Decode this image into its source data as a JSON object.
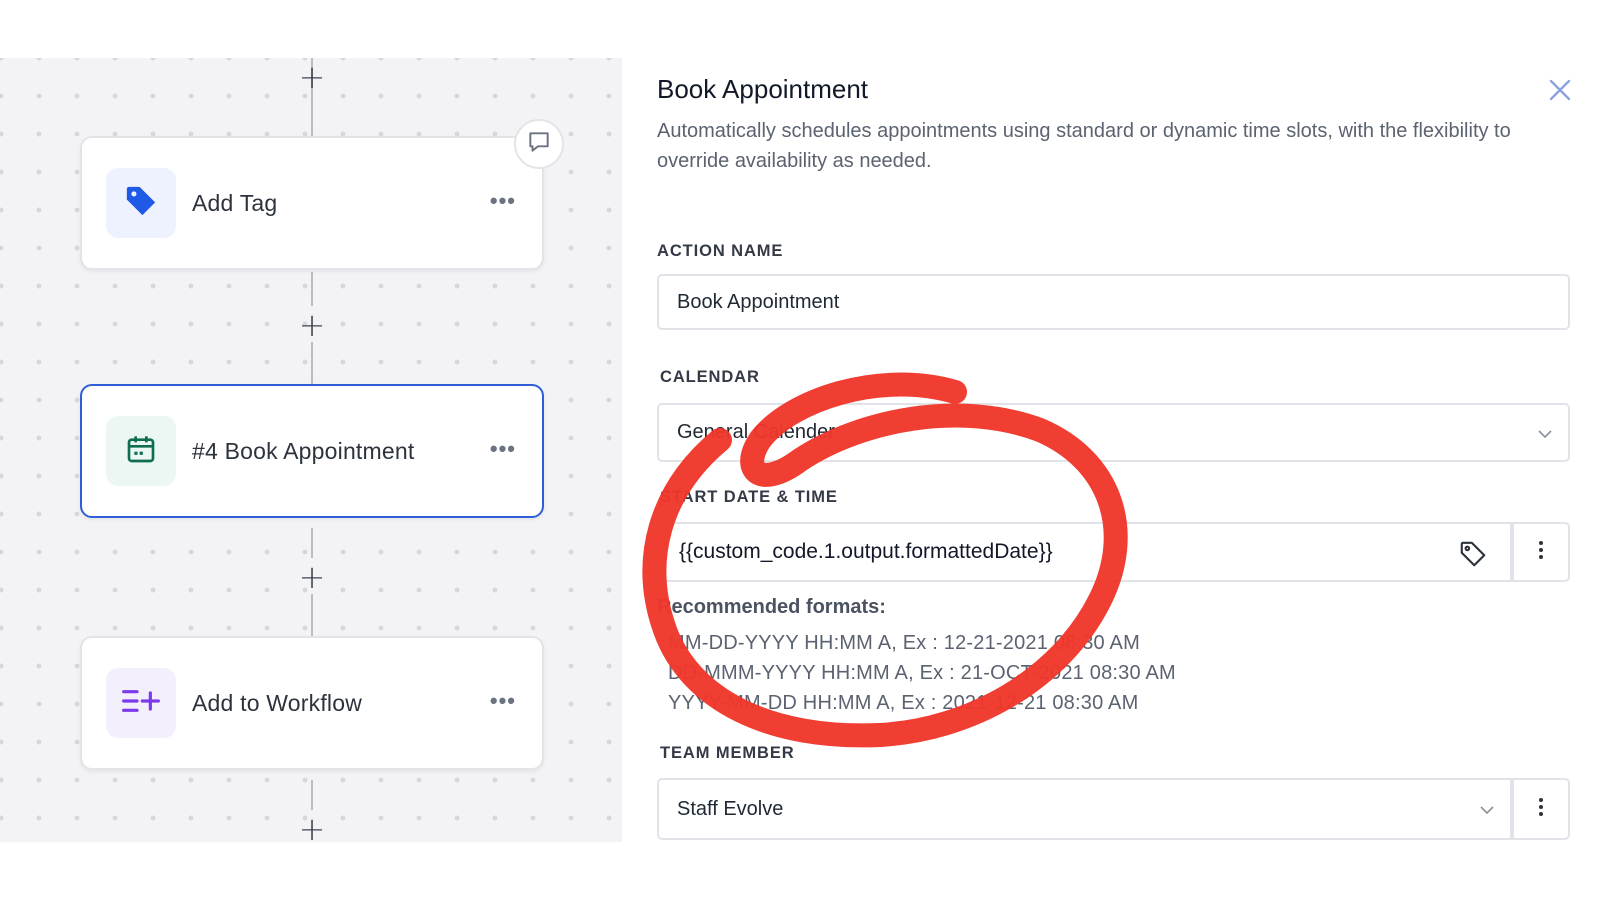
{
  "canvas": {
    "nodes": [
      {
        "label": "Add Tag",
        "icon": "tag-icon",
        "icon_color": "#1f5ae6",
        "icon_bg": "#eef2fe",
        "menu": "•••"
      },
      {
        "label": "#4 Book Appointment",
        "icon": "calendar-icon",
        "icon_color": "#0f6e52",
        "icon_bg": "#ecf7f3",
        "menu": "•••",
        "selected": true
      },
      {
        "label": "Add to Workflow",
        "icon": "add-to-list-icon",
        "icon_color": "#7c3aed",
        "icon_bg": "#f4effd",
        "menu": "•••"
      }
    ],
    "add_step": "+"
  },
  "panel": {
    "title": "Book Appointment",
    "description": "Automatically schedules appointments using standard or dynamic time slots, with the flexibility to override availability as needed.",
    "action_name": {
      "label": "ACTION NAME",
      "value": "Book Appointment"
    },
    "calendar": {
      "label": "CALENDAR",
      "value": "General Calender"
    },
    "start_date_time": {
      "label": "START DATE & TIME",
      "value": "{{custom_code.1.output.formattedDate}}"
    },
    "recommended_formats": {
      "title": "Recommended formats:",
      "items": [
        "MM-DD-YYYY HH:MM A, Ex : 12-21-2021 08:30 AM",
        "DD-MMM-YYYY HH:MM A, Ex : 21-OCT-2021 08:30 AM",
        "YYYY-MM-DD HH:MM A, Ex : 2021-12-21 08:30 AM"
      ]
    },
    "team_member": {
      "label": "TEAM MEMBER",
      "value": "Staff Evolve"
    }
  },
  "colors": {
    "accent": "#2f5fd7",
    "annotation": "#f0362b",
    "close": "#8ca2e0"
  }
}
